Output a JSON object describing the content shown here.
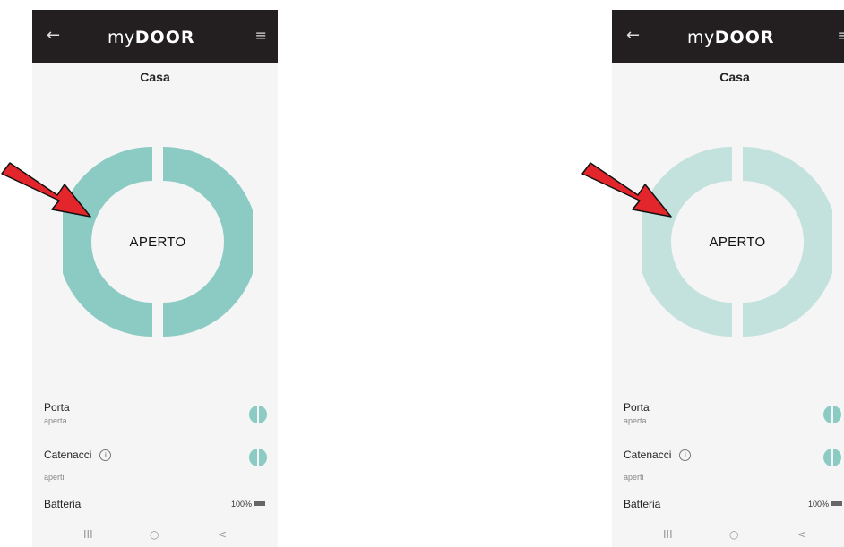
{
  "screens": [
    {
      "app_name_prefix": "my",
      "app_name_main": "DOOR",
      "back_icon": "←",
      "menu_icon": "≡",
      "title": "Casa",
      "status": "APERTO",
      "ring_color": "#8ccbc4",
      "porta_label": "Porta",
      "porta_state": "aperta",
      "catenacci_label": "Catenacci",
      "info_icon": "i",
      "catenacci_state": "aperti",
      "battery_label": "Batteria",
      "battery_value": "100%",
      "nav_recent": "III",
      "nav_home": "○",
      "nav_back": "<"
    },
    {
      "app_name_prefix": "my",
      "app_name_main": "DOOR",
      "back_icon": "←",
      "menu_icon": "≡",
      "title": "Casa",
      "status": "APERTO",
      "ring_color": "#c3e2de",
      "porta_label": "Porta",
      "porta_state": "aperta",
      "catenacci_label": "Catenacci",
      "info_icon": "i",
      "catenacci_state": "aperti",
      "battery_label": "Batteria",
      "battery_value": "100%",
      "nav_recent": "III",
      "nav_home": "○",
      "nav_back": "<"
    }
  ],
  "colors": {
    "appbar": "#231f20",
    "toggle": "#8ccbc4",
    "arrow": "#e3262b"
  }
}
